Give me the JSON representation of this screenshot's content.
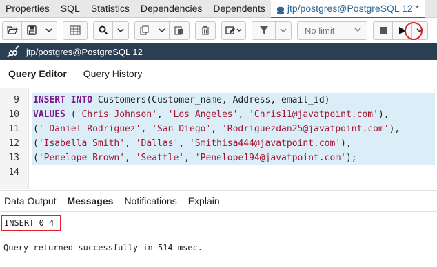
{
  "top_tabs": [
    "Properties",
    "SQL",
    "Statistics",
    "Dependencies",
    "Dependents"
  ],
  "active_tab": "jtp/postgres@PostgreSQL 12 *",
  "toolbar": {
    "limit_label": "No limit"
  },
  "connection": {
    "label": "jtp/postgres@PostgreSQL 12"
  },
  "editor_tabs": [
    "Query Editor",
    "Query History"
  ],
  "code_lines": [
    {
      "num": "9"
    },
    {
      "num": "10"
    },
    {
      "num": "11"
    },
    {
      "num": "12"
    },
    {
      "num": "13"
    },
    {
      "num": "14"
    }
  ],
  "code_tokens": {
    "l9_kw": "INSERT INTO",
    "l9_rest": " Customers(Customer_name, Address, email_id)",
    "l10_kw": "VALUES",
    "l10_a": " (",
    "l10_s1": "'Chris Johnson'",
    "l10_b": ", ",
    "l10_s2": "'Los Angeles'",
    "l10_c": ", ",
    "l10_s3": "'Chris11@javatpoint.com'",
    "l10_d": "),",
    "l11_a": "(",
    "l11_s1": "' Daniel Rodriguez'",
    "l11_b": ", ",
    "l11_s2": "'San Diego'",
    "l11_c": ", ",
    "l11_s3": "'Rodriguezdan25@javatpoint.com'",
    "l11_d": "),",
    "l12_a": "(",
    "l12_s1": "'Isabella Smith'",
    "l12_b": ", ",
    "l12_s2": "'Dallas'",
    "l12_c": ", ",
    "l12_s3": "'Smithisa444@javatpoint.com'",
    "l12_d": "),",
    "l13_a": "(",
    "l13_s1": "'Penelope Brown'",
    "l13_b": ", ",
    "l13_s2": "'Seattle'",
    "l13_c": ", ",
    "l13_s3": "'Penelope194@javatpoint.com'",
    "l13_d": ");"
  },
  "result_tabs": [
    "Data Output",
    "Messages",
    "Notifications",
    "Explain"
  ],
  "messages": {
    "status": "INSERT 0 4",
    "detail": "Query returned successfully in 514 msec."
  },
  "colors": {
    "accent": "#326690",
    "connection_bar": "#2a3f54",
    "highlight_red": "#e0202a",
    "selection": "#dbeef8"
  }
}
